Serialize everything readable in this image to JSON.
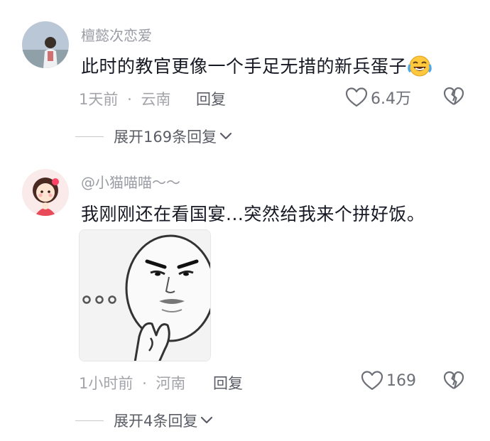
{
  "comments": [
    {
      "username": "檀懿次恋爱",
      "content": "此时的教官更像一个手足无措的新兵蛋子",
      "emoji_icon": "laugh-cry-emoji-icon",
      "time": "1天前",
      "separator": "·",
      "location": "云南",
      "reply_label": "回复",
      "likes": "6.4万",
      "expand_label": "展开169条回复"
    },
    {
      "username": "@小猫喵喵～～",
      "content": "我刚刚还在看国宴...突然给我来个拼好饭。",
      "sticker_icon": "thinking-meme-face-sticker",
      "time": "1小时前",
      "separator": "·",
      "location": "河南",
      "reply_label": "回复",
      "likes": "169",
      "expand_label": "展开4条回复"
    }
  ],
  "colors": {
    "primary_text": "#161823",
    "secondary_text": "#9a9ca3",
    "action_text": "#5b5d66"
  }
}
